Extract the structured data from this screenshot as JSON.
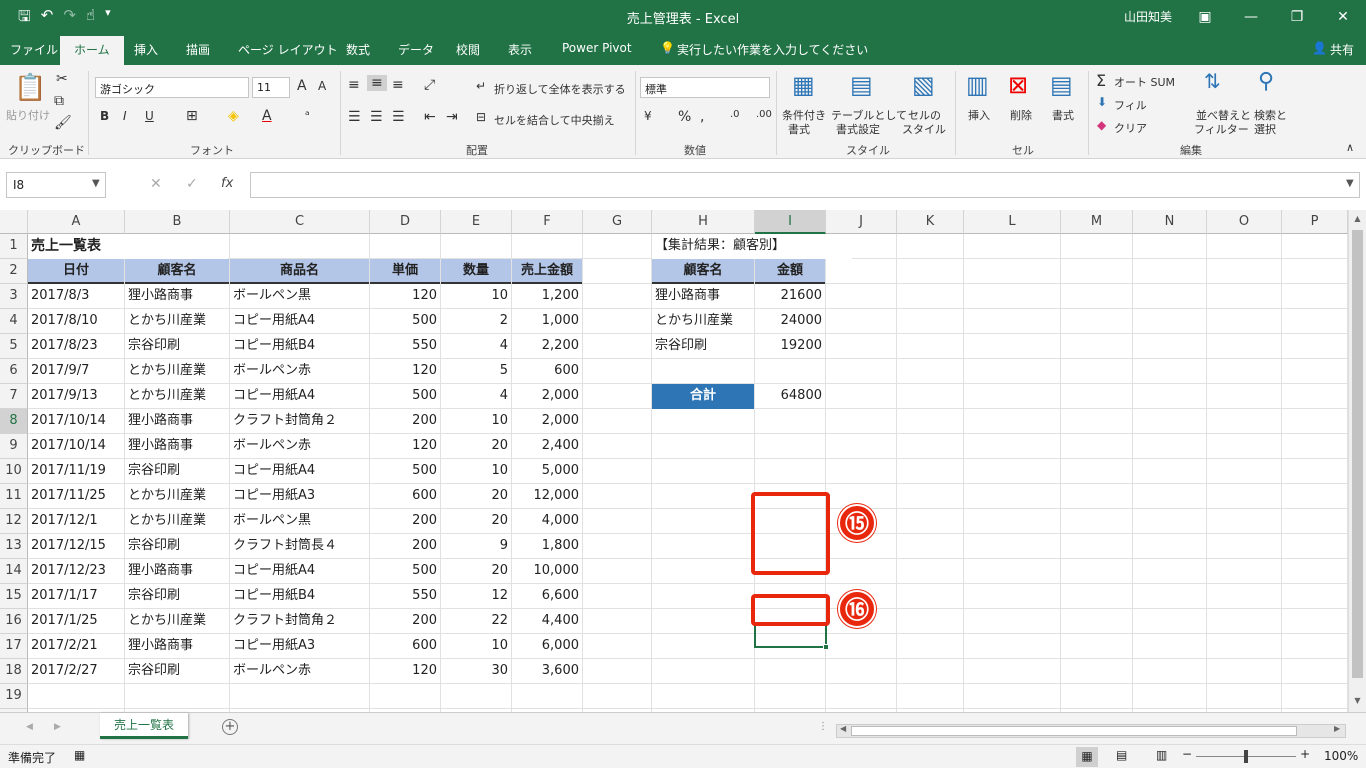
{
  "window": {
    "title": "売上管理表 - Excel",
    "user": "山田知美"
  },
  "tabs": [
    "ファイル",
    "ホーム",
    "挿入",
    "描画",
    "ページ レイアウト",
    "数式",
    "データ",
    "校閲",
    "表示",
    "Power Pivot"
  ],
  "tell_me": "実行したい作業を入力してください",
  "share": "共有",
  "ribbon": {
    "clipboard": {
      "paste": "貼り付け",
      "label": "クリップボード"
    },
    "font": {
      "name": "游ゴシック",
      "size": "11",
      "label": "フォント"
    },
    "align": {
      "wrap": "折り返して全体を表示する",
      "merge": "セルを結合して中央揃え",
      "label": "配置"
    },
    "number": {
      "format": "標準",
      "label": "数値"
    },
    "styles": {
      "cond1": "条件付き",
      "cond2": "書式",
      "table1": "テーブルとして",
      "table2": "書式設定",
      "cell1": "セルの",
      "cell2": "スタイル",
      "label": "スタイル"
    },
    "cells": {
      "insert": "挿入",
      "delete": "削除",
      "format": "書式",
      "label": "セル"
    },
    "edit": {
      "autosum": "オート SUM",
      "fill": "フィル",
      "clear": "クリア",
      "sort1": "並べ替えと",
      "sort2": "フィルター",
      "find1": "検索と",
      "find2": "選択",
      "label": "編集"
    }
  },
  "namebox": "I8",
  "columns": [
    "A",
    "B",
    "C",
    "D",
    "E",
    "F",
    "G",
    "H",
    "I",
    "J",
    "K",
    "L",
    "M",
    "N",
    "O",
    "P"
  ],
  "sheet": {
    "title": "売上一覧表",
    "headers": [
      "日付",
      "顧客名",
      "商品名",
      "単価",
      "数量",
      "売上金額"
    ],
    "rows": [
      [
        "2017/8/3",
        "狸小路商事",
        "ボールペン黒",
        "120",
        "10",
        "1,200"
      ],
      [
        "2017/8/10",
        "とかち川産業",
        "コピー用紙A4",
        "500",
        "2",
        "1,000"
      ],
      [
        "2017/8/23",
        "宗谷印刷",
        "コピー用紙B4",
        "550",
        "4",
        "2,200"
      ],
      [
        "2017/9/7",
        "とかち川産業",
        "ボールペン赤",
        "120",
        "5",
        "600"
      ],
      [
        "2017/9/13",
        "とかち川産業",
        "コピー用紙A4",
        "500",
        "4",
        "2,000"
      ],
      [
        "2017/10/14",
        "狸小路商事",
        "クラフト封筒角２",
        "200",
        "10",
        "2,000"
      ],
      [
        "2017/10/14",
        "狸小路商事",
        "ボールペン赤",
        "120",
        "20",
        "2,400"
      ],
      [
        "2017/11/19",
        "宗谷印刷",
        "コピー用紙A4",
        "500",
        "10",
        "5,000"
      ],
      [
        "2017/11/25",
        "とかち川産業",
        "コピー用紙A3",
        "600",
        "20",
        "12,000"
      ],
      [
        "2017/12/1",
        "とかち川産業",
        "ボールペン黒",
        "200",
        "20",
        "4,000"
      ],
      [
        "2017/12/15",
        "宗谷印刷",
        "クラフト封筒長４",
        "200",
        "9",
        "1,800"
      ],
      [
        "2017/12/23",
        "狸小路商事",
        "コピー用紙A4",
        "500",
        "20",
        "10,000"
      ],
      [
        "2017/1/17",
        "宗谷印刷",
        "コピー用紙B4",
        "550",
        "12",
        "6,600"
      ],
      [
        "2017/1/25",
        "とかち川産業",
        "クラフト封筒角２",
        "200",
        "22",
        "4,400"
      ],
      [
        "2017/2/21",
        "狸小路商事",
        "コピー用紙A3",
        "600",
        "10",
        "6,000"
      ],
      [
        "2017/2/27",
        "宗谷印刷",
        "ボールペン赤",
        "120",
        "30",
        "3,600"
      ]
    ],
    "summary": {
      "title": "【集計結果：顧客別】",
      "headers": [
        "顧客名",
        "金額"
      ],
      "rows": [
        [
          "狸小路商事",
          "21600"
        ],
        [
          "とかち川産業",
          "24000"
        ],
        [
          "宗谷印刷",
          "19200"
        ]
      ],
      "total_label": "合計",
      "total": "64800"
    }
  },
  "badges": [
    "⑮",
    "⑯"
  ],
  "sheet_tab": "売上一覧表",
  "status": {
    "ready": "準備完了",
    "zoom": "100%"
  },
  "colors": {
    "accent": "#217346",
    "header_fill": "#b4c6e7",
    "total_fill": "#2e75b6",
    "highlight": "#e8270d"
  }
}
